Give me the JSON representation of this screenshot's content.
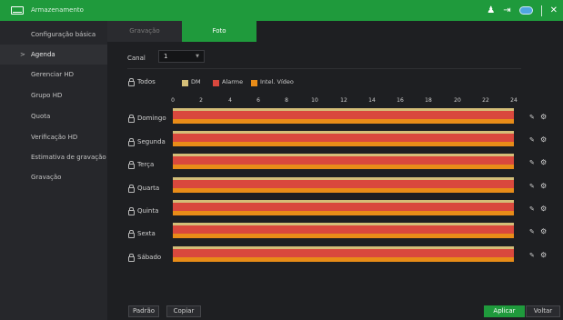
{
  "window": {
    "title": "Armazenamento",
    "title_icon": "storage-icon"
  },
  "toolbar_icons": [
    "users-icon",
    "logout-icon",
    "cloud-icon",
    "close-icon"
  ],
  "sidebar": {
    "items": [
      {
        "label": "Configuração básica"
      },
      {
        "label": "Agenda",
        "arrow": ">"
      },
      {
        "label": "Gerenciar HD"
      },
      {
        "label": "Grupo HD"
      },
      {
        "label": "Quota"
      },
      {
        "label": "Verificação HD"
      },
      {
        "label": "Estimativa de gravação"
      },
      {
        "label": "Gravação"
      }
    ]
  },
  "tabs": [
    {
      "label": "Gravação"
    },
    {
      "label": "Foto"
    }
  ],
  "canal": {
    "label": "Canal",
    "value": "1"
  },
  "legend": {
    "all_label": "Todos",
    "items": [
      {
        "label": "DM",
        "color": "#d4be78"
      },
      {
        "label": "Alarme",
        "color": "#d9483d"
      },
      {
        "label": "Intel. Vídeo",
        "color": "#e88c18"
      }
    ]
  },
  "timeline": {
    "ticks": [
      "0",
      "2",
      "4",
      "6",
      "8",
      "10",
      "12",
      "14",
      "16",
      "18",
      "20",
      "22",
      "24"
    ]
  },
  "days": [
    {
      "label": "Domingo"
    },
    {
      "label": "Segunda"
    },
    {
      "label": "Terça"
    },
    {
      "label": "Quarta"
    },
    {
      "label": "Quinta"
    },
    {
      "label": "Sexta"
    },
    {
      "label": "Sábado"
    }
  ],
  "buttons": {
    "default": "Padrão",
    "copy": "Copiar",
    "apply": "Aplicar",
    "back": "Voltar"
  }
}
